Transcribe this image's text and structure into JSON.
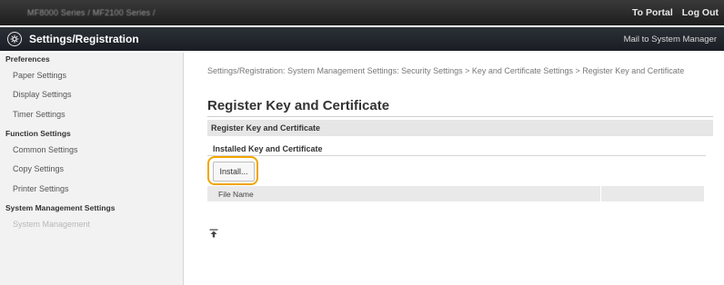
{
  "topbar": {
    "device_name": "MF8000 Series / MF2100 Series /",
    "to_portal": "To Portal",
    "log_out": "Log Out"
  },
  "header": {
    "title": "Settings/Registration",
    "mail": "Mail to System Manager"
  },
  "sidebar": {
    "preferences": {
      "heading": "Preferences",
      "items": [
        "Paper Settings",
        "Display Settings",
        "Timer Settings"
      ]
    },
    "function": {
      "heading": "Function Settings",
      "items": [
        "Common Settings",
        "Copy Settings",
        "Printer Settings"
      ]
    },
    "system": {
      "heading": "System Management Settings",
      "items": [
        "System Management"
      ]
    }
  },
  "main": {
    "breadcrumb": "Settings/Registration: System Management Settings: Security Settings > Key and Certificate Settings > Register Key and Certificate",
    "page_title": "Register Key and Certificate",
    "section_title": "Register Key and Certificate",
    "subsection_title": "Installed Key and Certificate",
    "install_label": "Install...",
    "file_name_header": "File Name"
  },
  "colors": {
    "highlight": "#f2a500",
    "topbar": "#2a2a2a",
    "header": "#22262c"
  },
  "icons": {
    "header": "gear-icon",
    "back_to_top": "back-to-top-icon"
  }
}
